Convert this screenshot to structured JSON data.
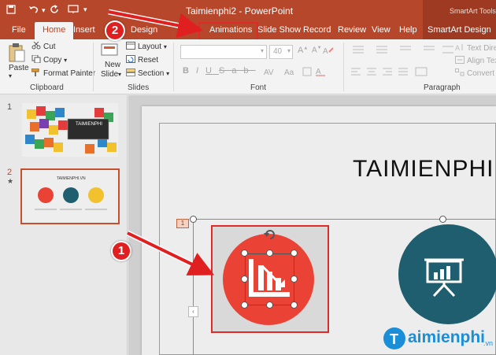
{
  "window": {
    "title": "Taimienphi2 - PowerPoint",
    "contextual_tools": "SmartArt Tools"
  },
  "quick_access": {
    "save_icon": "save-icon",
    "undo_icon": "undo-icon",
    "redo_icon": "redo-icon",
    "present_icon": "present-icon"
  },
  "tabs": [
    {
      "label": "File"
    },
    {
      "label": "Home"
    },
    {
      "label": "Insert"
    },
    {
      "label": "Design"
    },
    {
      "label": "Animations"
    },
    {
      "label": "Slide Show"
    },
    {
      "label": "Record"
    },
    {
      "label": "Review"
    },
    {
      "label": "View"
    },
    {
      "label": "Help"
    },
    {
      "label": "SmartArt Design"
    }
  ],
  "ribbon": {
    "clipboard": {
      "paste": "Paste",
      "cut": "Cut",
      "copy": "Copy",
      "format_painter": "Format Painter",
      "group_label": "Clipboard"
    },
    "slides": {
      "new_slide_line1": "New",
      "new_slide_line2": "Slide",
      "layout": "Layout",
      "reset": "Reset",
      "section": "Section",
      "group_label": "Slides"
    },
    "font": {
      "font_size": "40",
      "group_label": "Font"
    },
    "paragraph": {
      "text_direction": "Text Dire",
      "align_text": "Align Tex",
      "convert_to": "Convert to",
      "group_label": "Paragraph"
    }
  },
  "thumbnails": [
    {
      "number": "1",
      "title": "TAIMIENPHI"
    },
    {
      "number": "2",
      "title": "TAIMIENPHI.VN",
      "marker": "★"
    }
  ],
  "slide": {
    "title": "TAIMIENPHI.",
    "smartart_tag": "1",
    "pane_toggle": "‹"
  },
  "annotations": {
    "badge_1": "1",
    "badge_2": "2"
  },
  "watermark": {
    "text": "aimienphi",
    "suffix": ".vn"
  },
  "colors": {
    "brand": "#b7472a",
    "accent_red": "#ea4335",
    "teal": "#1f5e6e",
    "annotation_red": "#e02020"
  }
}
